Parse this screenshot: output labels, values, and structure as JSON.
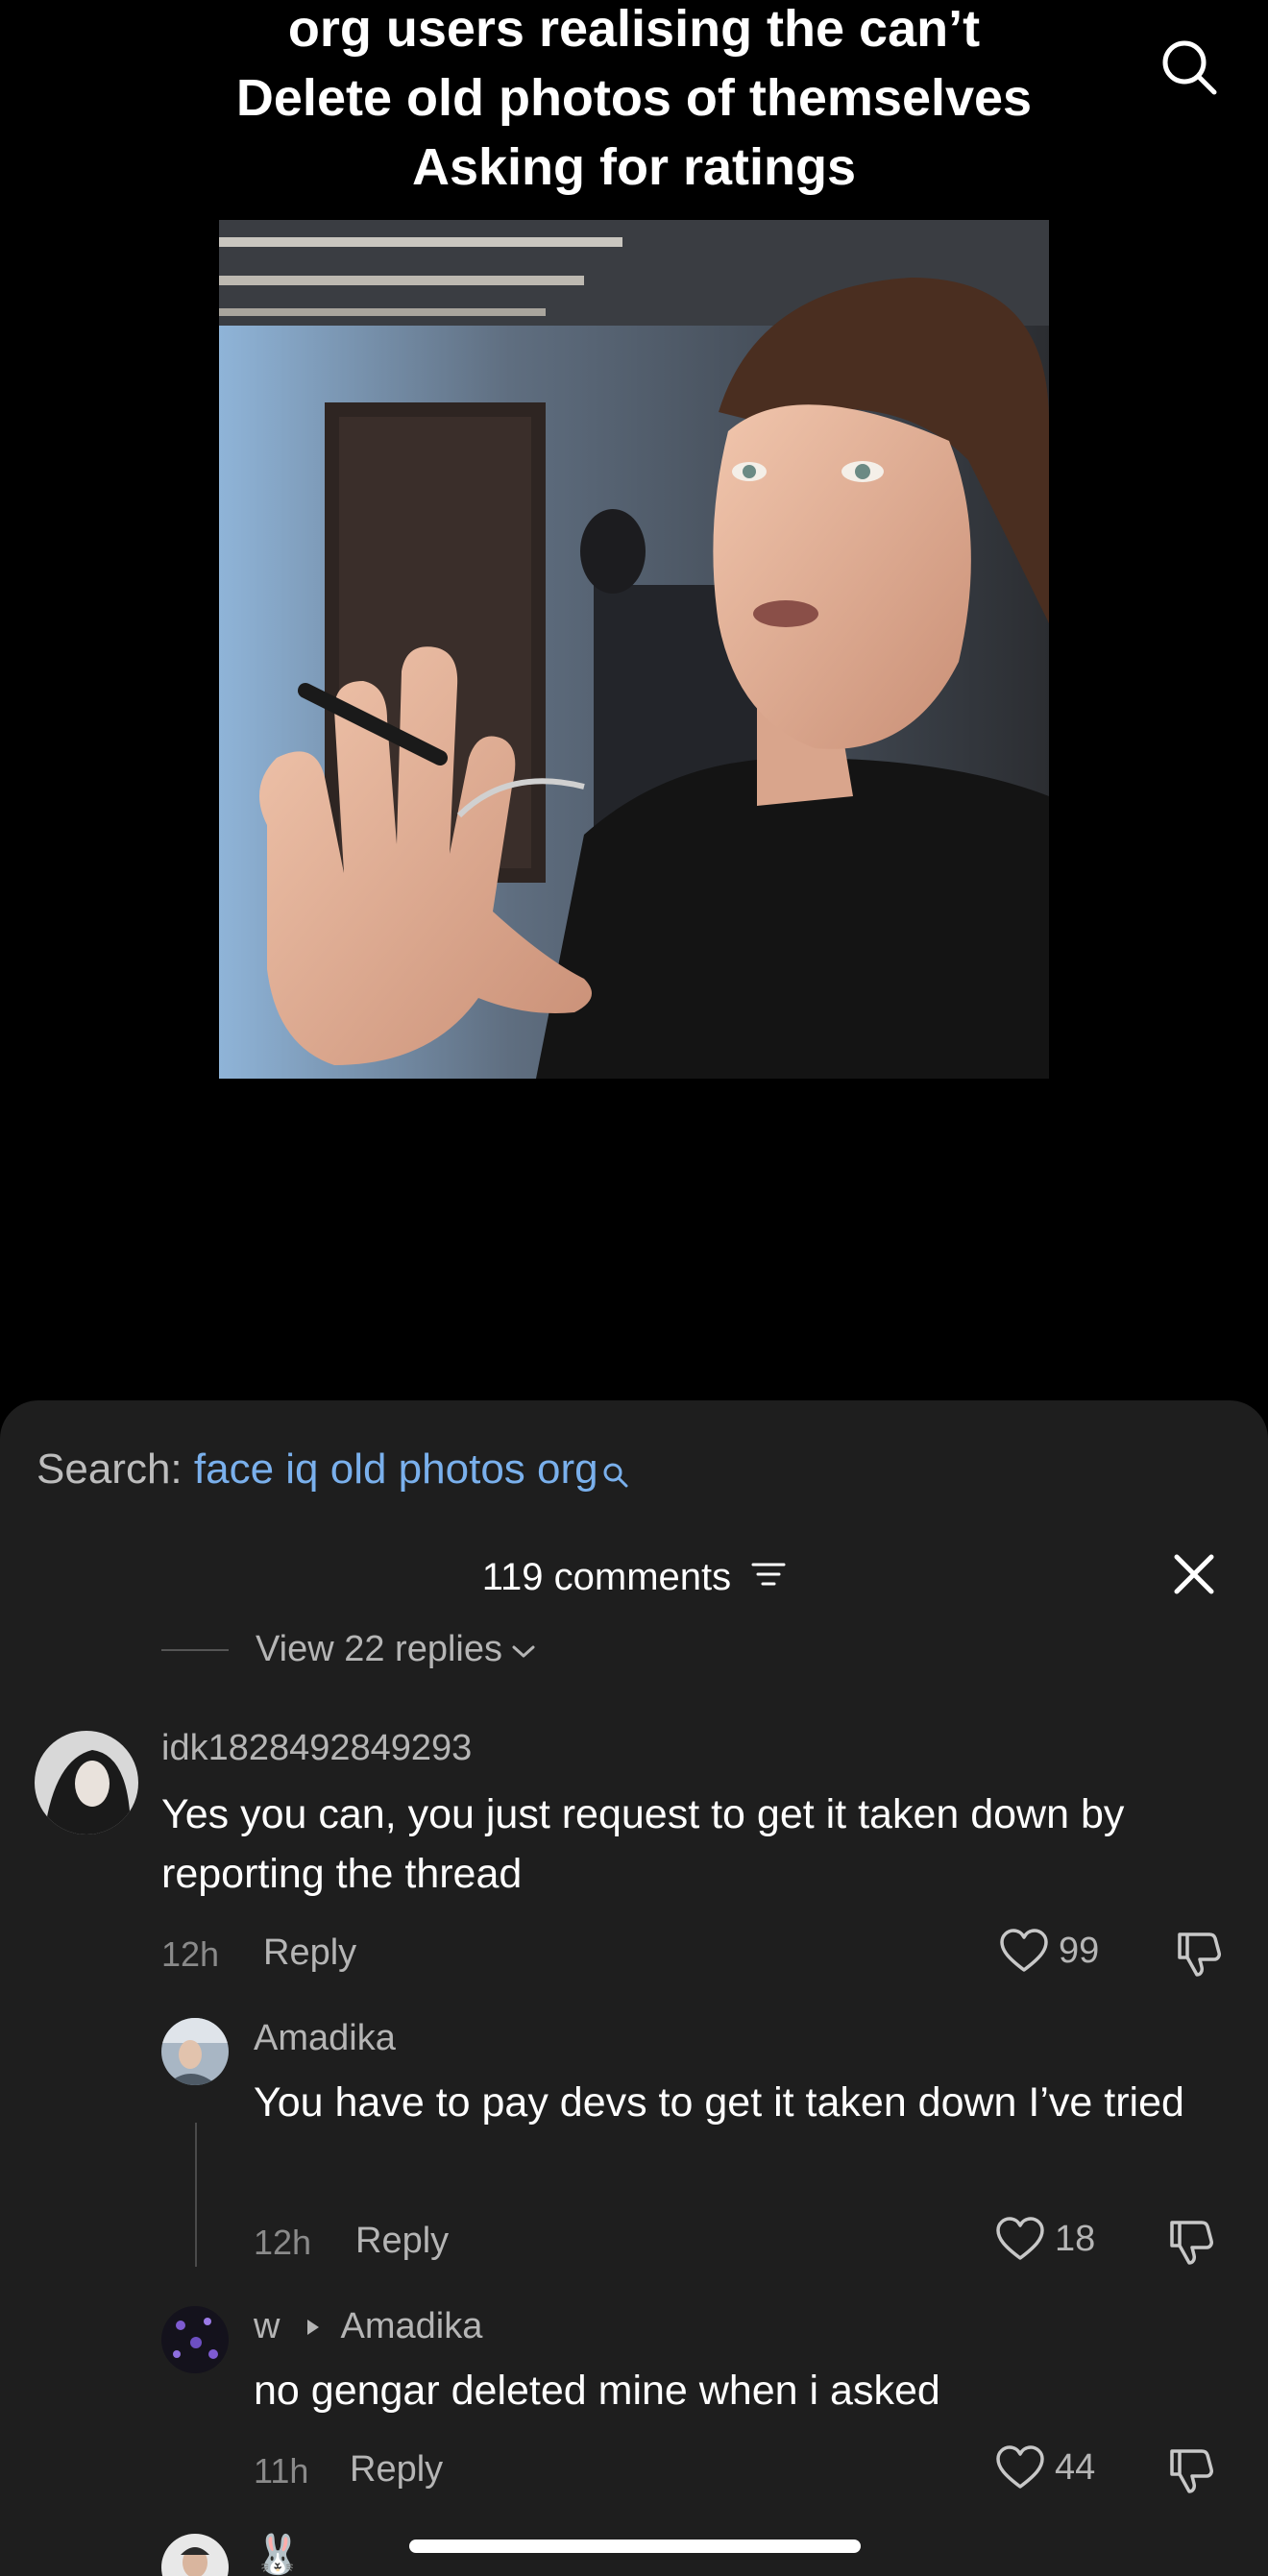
{
  "video": {
    "caption_lines": [
      "org users realising the can’t",
      "Delete old photos of themselves",
      "Asking for ratings"
    ]
  },
  "top_bar": {
    "search_icon": "search-icon"
  },
  "comments_sheet": {
    "search_label": "Search:",
    "search_query": "face iq old photos org",
    "comment_count": "119 comments",
    "view_replies": "View 22 replies",
    "comments": [
      {
        "username": "idk1828492849293",
        "text": "Yes you can, you just request to get it taken down by reporting the thread",
        "time": "12h",
        "reply_label": "Reply",
        "likes": "99"
      },
      {
        "username": "Amadika",
        "text": "You have to pay devs to get it taken down I’ve tried",
        "time": "12h",
        "reply_label": "Reply",
        "likes": "18"
      },
      {
        "username": "w",
        "reply_to": "Amadika",
        "text": "no gengar deleted mine when i asked",
        "time": "11h",
        "reply_label": "Reply",
        "likes": "44"
      }
    ],
    "next_partial_emoji": "🐰"
  },
  "colors": {
    "background": "#000000",
    "sheet": "#1e1e1e",
    "link_blue": "#7ab0ec",
    "muted_text": "#b5b5b5"
  }
}
